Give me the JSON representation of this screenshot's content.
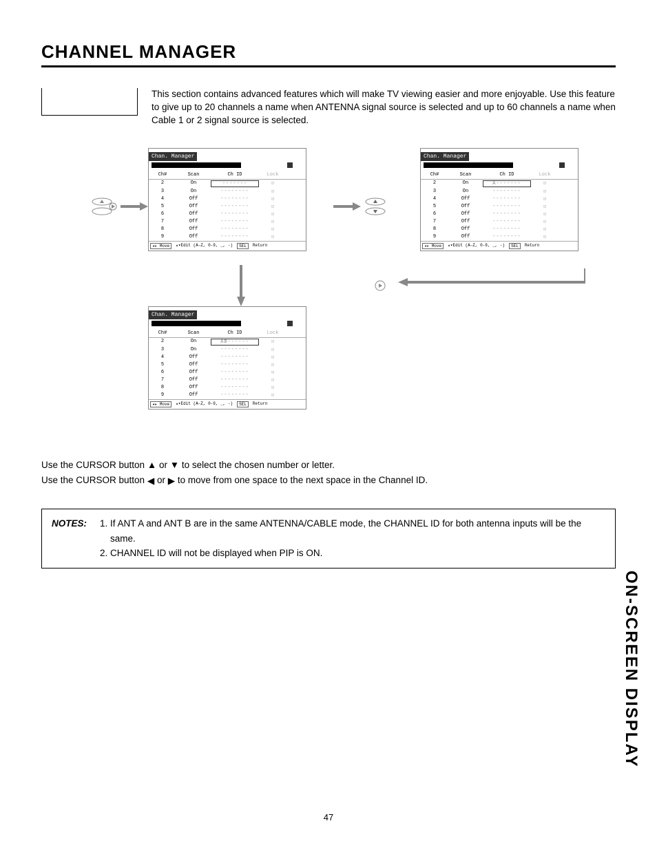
{
  "title": "CHANNEL MANAGER",
  "intro": "This section contains advanced features which will make TV viewing easier and more enjoyable. Use this feature to give up to 20 channels a name when ANTENNA signal source is selected and up to 60 channels a name when Cable 1 or 2 signal source is selected.",
  "screen": {
    "header": "Chan. Manager",
    "cols": {
      "ch": "Ch#",
      "scan": "Scan",
      "chid": "Ch ID",
      "lock": "Lock"
    },
    "rows": [
      {
        "ch": "2",
        "scan": "On",
        "id1": "-------",
        "id2": "A-------",
        "id3": "AB------"
      },
      {
        "ch": "3",
        "scan": "On",
        "id1": "--------",
        "id2": "--------",
        "id3": "--------"
      },
      {
        "ch": "4",
        "scan": "Off",
        "id1": "--------",
        "id2": "--------",
        "id3": "--------"
      },
      {
        "ch": "5",
        "scan": "Off",
        "id1": "--------",
        "id2": "--------",
        "id3": "--------"
      },
      {
        "ch": "6",
        "scan": "Off",
        "id1": "--------",
        "id2": "--------",
        "id3": "--------"
      },
      {
        "ch": "7",
        "scan": "Off",
        "id1": "--------",
        "id2": "--------",
        "id3": "--------"
      },
      {
        "ch": "8",
        "scan": "Off",
        "id1": "--------",
        "id2": "--------",
        "id3": "--------"
      },
      {
        "ch": "9",
        "scan": "Off",
        "id1": "--------",
        "id2": "--------",
        "id3": "--------"
      }
    ],
    "footer": {
      "move": "Move",
      "edit": "Edit (A-Z, 0-9, _, -)",
      "return": "Return",
      "sel": "SEL"
    }
  },
  "instr1a": "Use the CURSOR button ",
  "instr1b": " or ",
  "instr1c": " to select the chosen number or letter.",
  "instr2a": "Use the CURSOR button ",
  "instr2b": " or ",
  "instr2c": " to move from one space to the next space in the Channel ID.",
  "notes": {
    "label": "NOTES:",
    "items": [
      "If ANT A and ANT B are in the same ANTENNA/CABLE mode, the CHANNEL ID for both antenna inputs will be the same.",
      "CHANNEL ID will not be displayed when PIP is ON."
    ]
  },
  "sideTitle": "ON-SCREEN DISPLAY",
  "pageNum": "47",
  "lockIcon": "⊡"
}
